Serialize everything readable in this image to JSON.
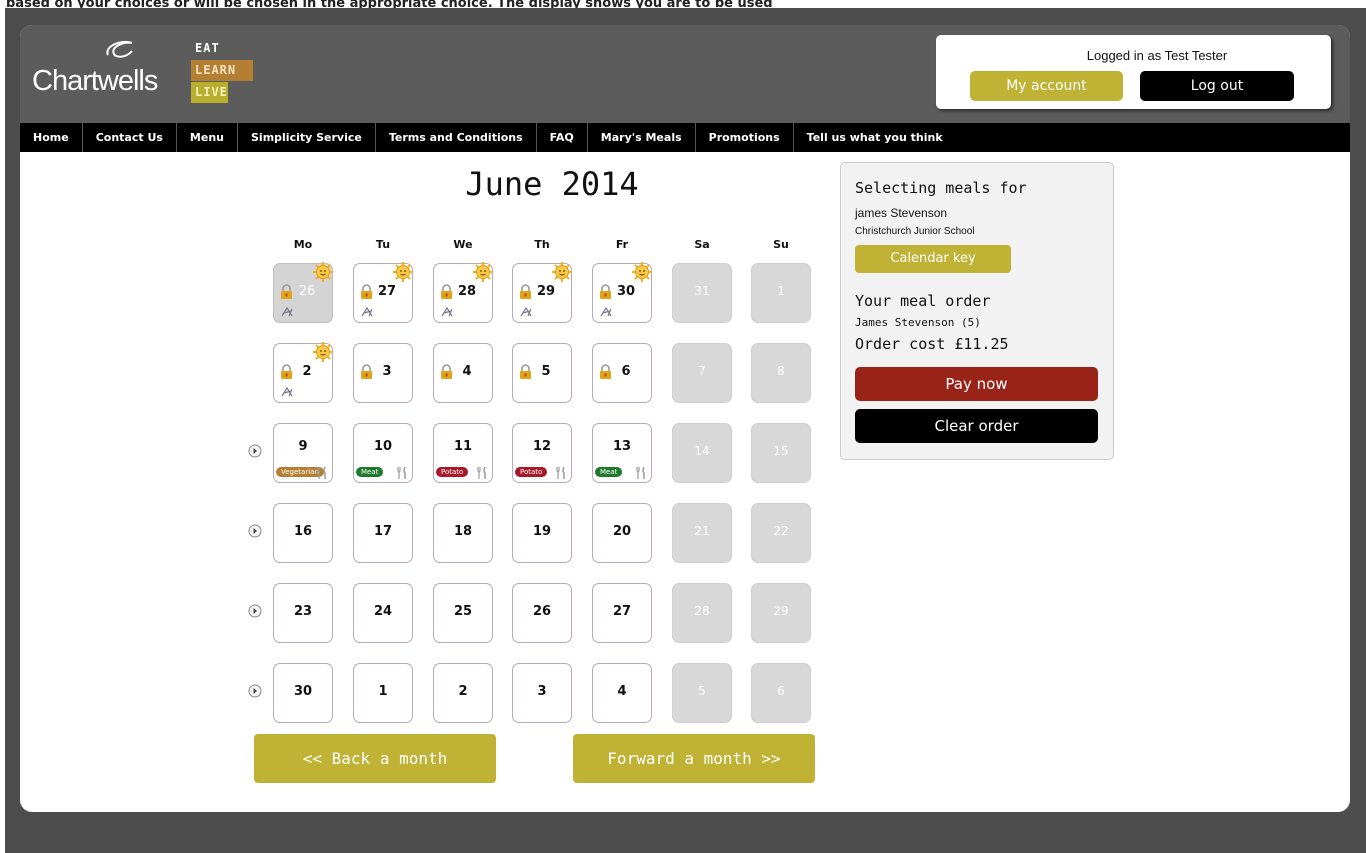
{
  "top_strip": "based on your choices or will be chosen in the appropriate choice. The display shows you are to be used",
  "brand": {
    "logo_text": "Chartwells",
    "tagline": [
      "EAT",
      "LEARN",
      "LIVE"
    ],
    "colors": {
      "header": "#5c5c5c",
      "learn": "#b57f33",
      "live": "#b8ad2c",
      "accent": "#c0b235",
      "pay": "#9a2317"
    }
  },
  "account": {
    "logged_in": "Logged in as Test Tester",
    "my_account": "My account",
    "log_out": "Log out"
  },
  "nav": [
    "Home",
    "Contact Us",
    "Menu",
    "Simplicity Service",
    "Terms and Conditions",
    "FAQ",
    "Mary's Meals",
    "Promotions",
    "Tell us what you think"
  ],
  "calendar": {
    "title": "June 2014",
    "weekdays": [
      "Mo",
      "Tu",
      "We",
      "Th",
      "Fr",
      "Sa",
      "Su"
    ],
    "weeks": [
      {
        "arrow": false,
        "days": [
          {
            "n": "26",
            "state": "past",
            "lock": true,
            "sun": true,
            "chair": true
          },
          {
            "n": "27",
            "state": "locked",
            "lock": true,
            "sun": true,
            "chair": true
          },
          {
            "n": "28",
            "state": "locked",
            "lock": true,
            "sun": true,
            "chair": true
          },
          {
            "n": "29",
            "state": "locked",
            "lock": true,
            "sun": true,
            "chair": true
          },
          {
            "n": "30",
            "state": "locked",
            "lock": true,
            "sun": true,
            "chair": true
          },
          {
            "n": "31",
            "state": "weekend"
          },
          {
            "n": "1",
            "state": "weekend"
          }
        ]
      },
      {
        "arrow": false,
        "days": [
          {
            "n": "2",
            "state": "locked",
            "lock": true,
            "sun": true,
            "chair": true
          },
          {
            "n": "3",
            "state": "locked",
            "lock": true
          },
          {
            "n": "4",
            "state": "locked",
            "lock": true
          },
          {
            "n": "5",
            "state": "locked",
            "lock": true
          },
          {
            "n": "6",
            "state": "locked",
            "lock": true
          },
          {
            "n": "7",
            "state": "weekend"
          },
          {
            "n": "8",
            "state": "weekend"
          }
        ]
      },
      {
        "arrow": true,
        "days": [
          {
            "n": "9",
            "state": "meal",
            "badge": "Vegetarian",
            "badge_color": "#b57f33"
          },
          {
            "n": "10",
            "state": "meal",
            "badge": "Meat",
            "badge_color": "#1e7a2a"
          },
          {
            "n": "11",
            "state": "meal",
            "badge": "Potato",
            "badge_color": "#a8182a"
          },
          {
            "n": "12",
            "state": "meal",
            "badge": "Potato",
            "badge_color": "#a8182a"
          },
          {
            "n": "13",
            "state": "meal",
            "badge": "Meat",
            "badge_color": "#1e7a2a"
          },
          {
            "n": "14",
            "state": "weekend"
          },
          {
            "n": "15",
            "state": "weekend"
          }
        ]
      },
      {
        "arrow": true,
        "days": [
          {
            "n": "16",
            "state": "open"
          },
          {
            "n": "17",
            "state": "open"
          },
          {
            "n": "18",
            "state": "open"
          },
          {
            "n": "19",
            "state": "open"
          },
          {
            "n": "20",
            "state": "open"
          },
          {
            "n": "21",
            "state": "weekend"
          },
          {
            "n": "22",
            "state": "weekend"
          }
        ]
      },
      {
        "arrow": true,
        "days": [
          {
            "n": "23",
            "state": "open"
          },
          {
            "n": "24",
            "state": "open"
          },
          {
            "n": "25",
            "state": "open"
          },
          {
            "n": "26",
            "state": "open"
          },
          {
            "n": "27",
            "state": "open"
          },
          {
            "n": "28",
            "state": "weekend"
          },
          {
            "n": "29",
            "state": "weekend"
          }
        ]
      },
      {
        "arrow": true,
        "days": [
          {
            "n": "30",
            "state": "open"
          },
          {
            "n": "1",
            "state": "open"
          },
          {
            "n": "2",
            "state": "open"
          },
          {
            "n": "3",
            "state": "open"
          },
          {
            "n": "4",
            "state": "open"
          },
          {
            "n": "5",
            "state": "weekend"
          },
          {
            "n": "6",
            "state": "weekend"
          }
        ]
      }
    ],
    "back_label": "<< Back a month",
    "forward_label": "Forward a month >>"
  },
  "sidebar": {
    "selecting": "Selecting meals for",
    "child_name": "james Stevenson",
    "school": "Christchurch Junior School",
    "calendar_key": "Calendar key",
    "order_heading": "Your meal order",
    "order_child": "James Stevenson (5)",
    "order_cost": "Order cost £11.25",
    "pay_now": "Pay now",
    "clear_order": "Clear order"
  }
}
